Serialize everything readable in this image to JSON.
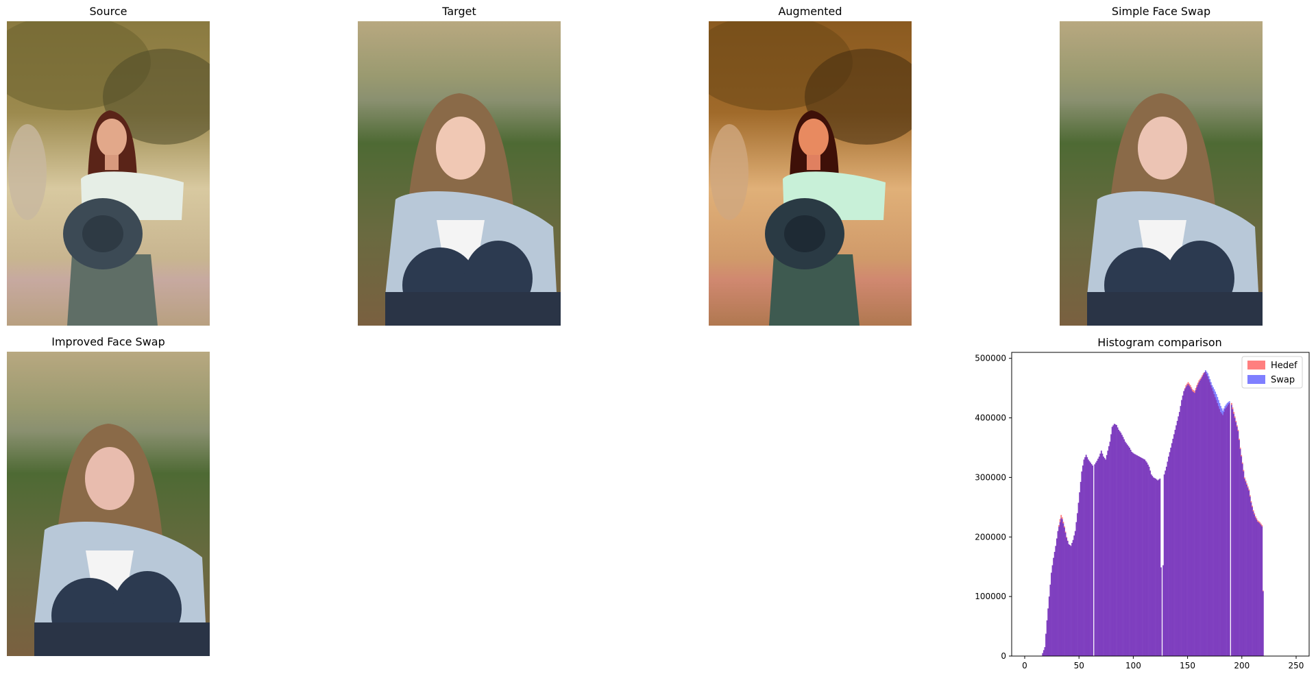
{
  "panels": {
    "source": "Source",
    "target": "Target",
    "augmented": "Augmented",
    "simple": "Simple Face Swap",
    "improved": "Improved Face Swap"
  },
  "colors": {
    "hedef": "#ff7f7f",
    "swap": "#7f7fff",
    "overlap": "#7f3fbf"
  },
  "chart_data": {
    "type": "bar",
    "title": "Histogram comparison",
    "xlabel": "",
    "ylabel": "",
    "xlim": [
      -12,
      262
    ],
    "ylim": [
      0,
      510000
    ],
    "xticks": [
      0,
      50,
      100,
      150,
      200,
      250
    ],
    "yticks": [
      0,
      100000,
      200000,
      300000,
      400000,
      500000
    ],
    "grid": false,
    "legend": {
      "placement": "top-right",
      "entries": [
        "Hedef",
        "Swap"
      ]
    },
    "x": [
      0,
      5,
      10,
      15,
      18,
      20,
      22,
      24,
      26,
      28,
      30,
      32,
      33,
      34,
      36,
      38,
      40,
      42,
      44,
      46,
      48,
      50,
      52,
      54,
      56,
      58,
      60,
      62,
      63,
      64,
      66,
      68,
      70,
      72,
      74,
      76,
      78,
      80,
      82,
      84,
      86,
      88,
      90,
      92,
      94,
      96,
      98,
      100,
      102,
      104,
      106,
      108,
      110,
      112,
      114,
      116,
      118,
      120,
      122,
      124,
      126,
      128,
      130,
      132,
      134,
      136,
      138,
      140,
      142,
      144,
      146,
      148,
      150,
      152,
      154,
      156,
      158,
      160,
      162,
      164,
      166,
      168,
      170,
      172,
      174,
      176,
      178,
      180,
      182,
      184,
      186,
      188,
      189,
      190,
      192,
      194,
      196,
      198,
      200,
      202,
      204,
      206,
      208,
      210,
      212,
      214,
      216,
      218,
      220,
      222,
      224,
      226,
      228,
      230,
      232,
      234,
      236,
      240,
      245,
      250,
      255
    ],
    "series": [
      {
        "name": "Hedef",
        "values": [
          0,
          0,
          0,
          0,
          15000,
          60000,
          100000,
          140000,
          165000,
          185000,
          210000,
          230000,
          237000,
          233000,
          218000,
          200000,
          188000,
          185000,
          195000,
          210000,
          240000,
          275000,
          310000,
          330000,
          338000,
          330000,
          325000,
          320000,
          0,
          322000,
          328000,
          335000,
          345000,
          335000,
          330000,
          345000,
          360000,
          385000,
          390000,
          388000,
          380000,
          375000,
          368000,
          360000,
          355000,
          350000,
          343000,
          340000,
          338000,
          336000,
          334000,
          332000,
          330000,
          325000,
          318000,
          305000,
          300000,
          298000,
          295000,
          298000,
          0,
          305000,
          318000,
          335000,
          350000,
          365000,
          380000,
          395000,
          410000,
          430000,
          445000,
          455000,
          460000,
          455000,
          448000,
          445000,
          455000,
          463000,
          468000,
          475000,
          478000,
          470000,
          460000,
          450000,
          440000,
          430000,
          420000,
          410000,
          405000,
          415000,
          420000,
          425000,
          0,
          425000,
          410000,
          395000,
          380000,
          350000,
          325000,
          300000,
          290000,
          280000,
          260000,
          245000,
          235000,
          228000,
          225000,
          220000,
          0,
          0,
          0,
          0,
          0,
          0,
          0,
          0,
          0,
          0,
          0
        ],
        "note": ""
      },
      {
        "name": "Swap",
        "values": [
          0,
          0,
          0,
          0,
          15000,
          60000,
          100000,
          140000,
          165000,
          185000,
          210000,
          225000,
          232000,
          230000,
          216000,
          199000,
          188000,
          185000,
          195000,
          210000,
          240000,
          275000,
          310000,
          330000,
          338000,
          330000,
          325000,
          320000,
          0,
          322000,
          328000,
          335000,
          345000,
          335000,
          330000,
          345000,
          360000,
          385000,
          390000,
          388000,
          380000,
          375000,
          368000,
          360000,
          355000,
          350000,
          343000,
          340000,
          338000,
          336000,
          334000,
          332000,
          330000,
          325000,
          318000,
          305000,
          300000,
          298000,
          295000,
          298000,
          0,
          305000,
          318000,
          335000,
          350000,
          365000,
          380000,
          395000,
          410000,
          430000,
          445000,
          452000,
          457000,
          452000,
          445000,
          442000,
          452000,
          460000,
          466000,
          473000,
          480000,
          475000,
          465000,
          455000,
          448000,
          440000,
          430000,
          420000,
          412000,
          420000,
          425000,
          428000,
          0,
          422000,
          407000,
          393000,
          378000,
          348000,
          323000,
          298000,
          288000,
          278000,
          258000,
          243000,
          233000,
          226000,
          223000,
          218000,
          0,
          0,
          0,
          0,
          0,
          0,
          0,
          0,
          0,
          0,
          0
        ]
      }
    ]
  }
}
